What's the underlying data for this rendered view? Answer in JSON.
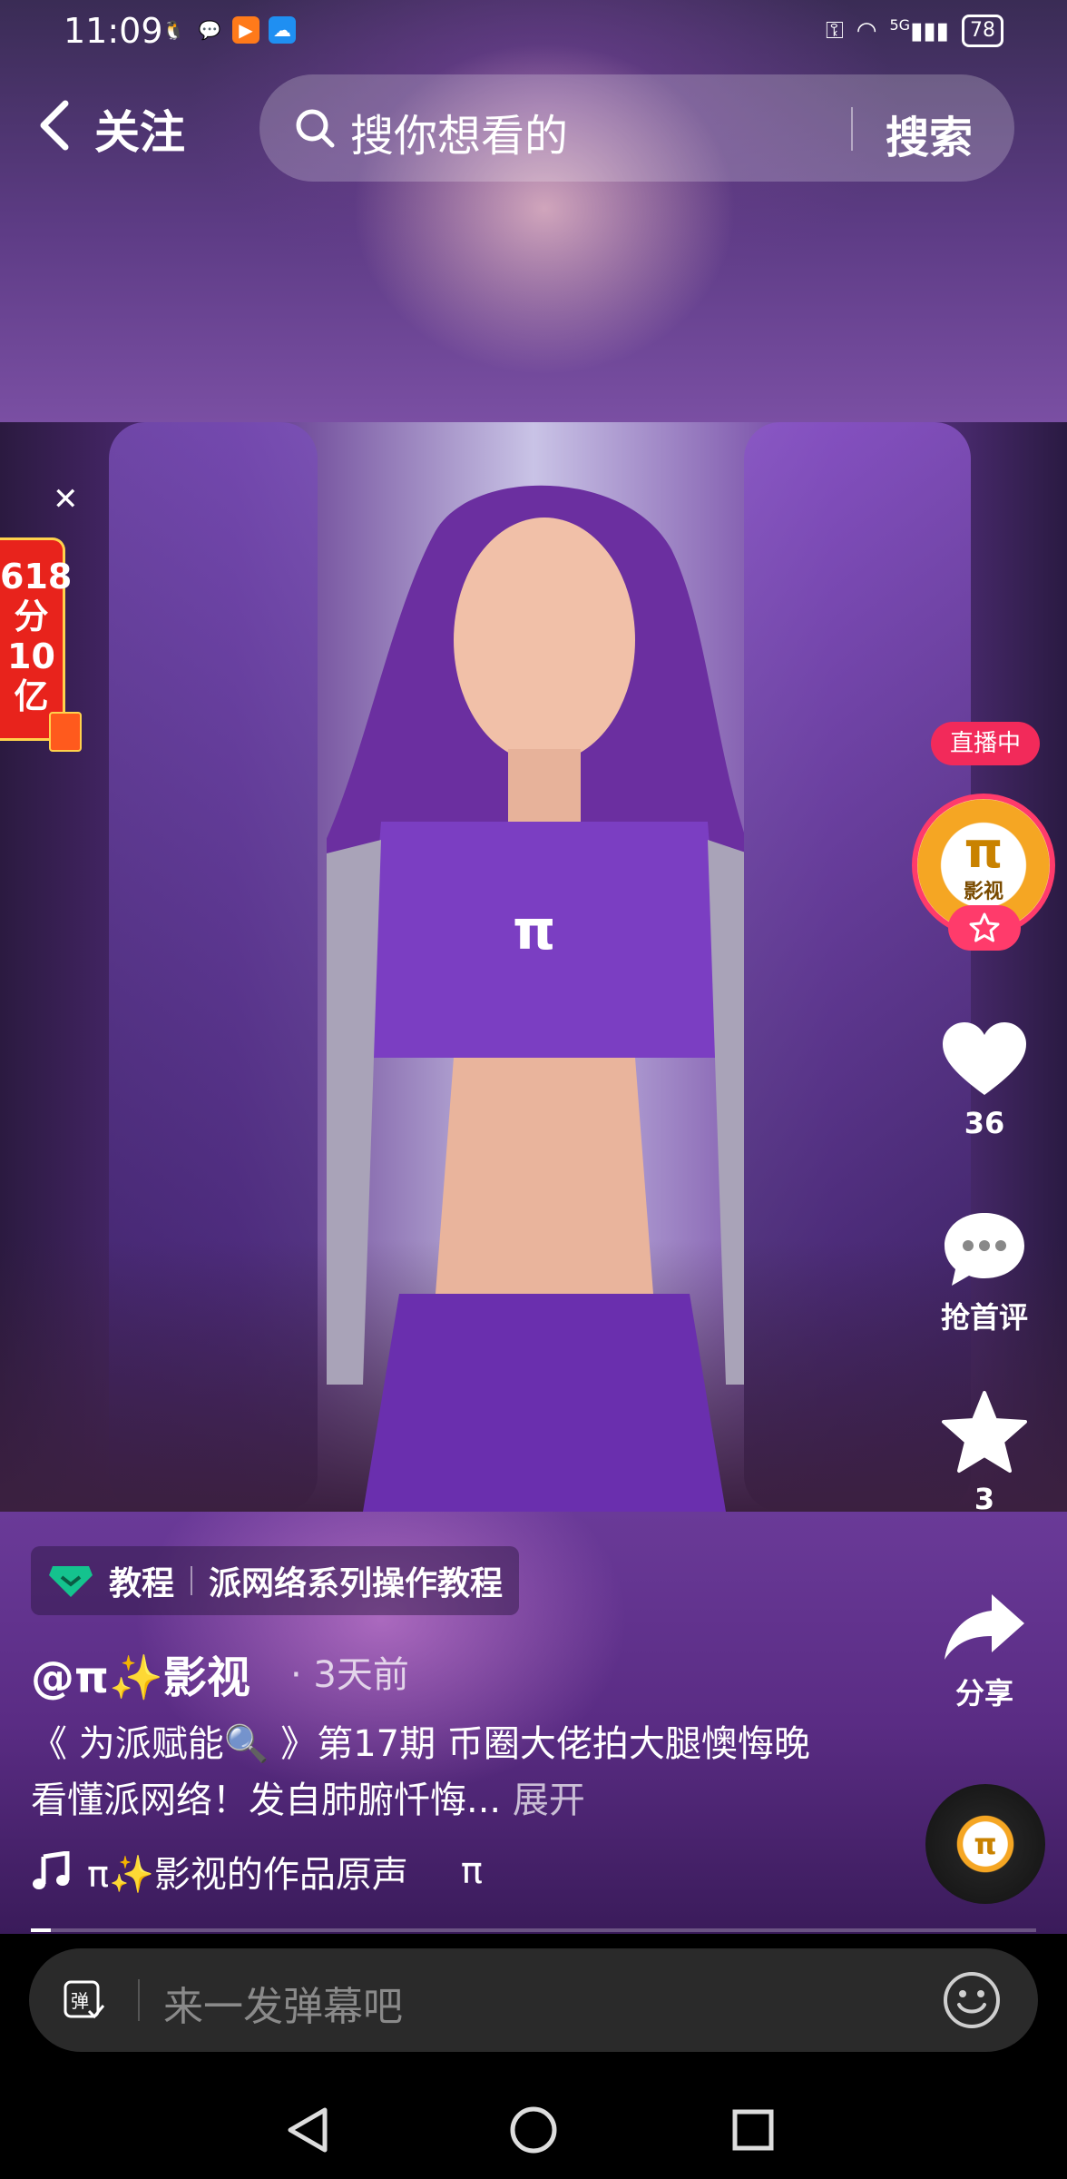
{
  "status_bar": {
    "time": "11:09",
    "battery": "78",
    "network": "5G"
  },
  "header": {
    "back_label": "关注",
    "search_placeholder": "搜你想看的",
    "search_button": "搜索"
  },
  "promo": {
    "lines": [
      "618",
      "分",
      "10",
      "亿"
    ]
  },
  "right_rail": {
    "live_badge": "直播中",
    "avatar_text": "影视",
    "like_count": "36",
    "comment_label": "抢首评",
    "favorite_count": "3",
    "share_label": "分享"
  },
  "video_info": {
    "tag_category": "教程",
    "tag_collection": "派网络系列操作教程",
    "author": "@π✨影视",
    "time_ago": "· 3天前",
    "description": "《 为派赋能🔍 》第17期 币圈大佬拍大腿懊悔晚看懂派网络！发自肺腑忏悔...",
    "expand": "展开",
    "music": "π✨影视的作品原声",
    "music_extra": "π"
  },
  "progress": 0.02,
  "comment_bar": {
    "placeholder": "来一发弹幕吧"
  },
  "icons": {
    "back": "chevron-left-icon",
    "search": "search-icon",
    "like": "heart-icon",
    "comment": "comment-bubble-icon",
    "favorite": "star-icon",
    "share": "share-arrow-icon",
    "music": "music-note-icon",
    "danmaku": "danmaku-icon",
    "emoji": "smile-icon"
  },
  "colors": {
    "accent": "#ff3b6b",
    "promo_red": "#e8231c",
    "tag_green": "#14c38e"
  }
}
